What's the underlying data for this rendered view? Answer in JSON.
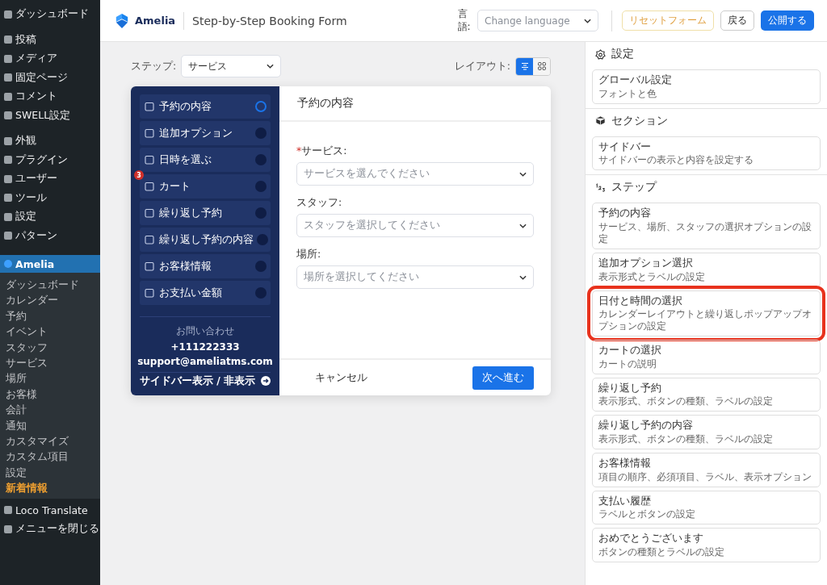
{
  "admin_menu": {
    "groups": [
      [
        {
          "label": "ダッシュボード",
          "selected": false
        }
      ],
      [
        {
          "label": "投稿",
          "selected": false
        },
        {
          "label": "メディア",
          "selected": false
        },
        {
          "label": "固定ページ",
          "selected": false
        },
        {
          "label": "コメント",
          "selected": false
        },
        {
          "label": "SWELL設定",
          "selected": false
        }
      ],
      [
        {
          "label": "外観",
          "selected": false
        },
        {
          "label": "プラグイン",
          "selected": false
        },
        {
          "label": "ユーザー",
          "selected": false
        },
        {
          "label": "ツール",
          "selected": false
        },
        {
          "label": "設定",
          "selected": false
        },
        {
          "label": "パターン",
          "selected": false
        }
      ]
    ],
    "current": {
      "label": "Amelia",
      "selected": true
    },
    "submenu": [
      {
        "label": "ダッシュボード",
        "accent": false
      },
      {
        "label": "カレンダー",
        "accent": false
      },
      {
        "label": "予約",
        "accent": false
      },
      {
        "label": "イベント",
        "accent": false
      },
      {
        "label": "スタッフ",
        "accent": false
      },
      {
        "label": "サービス",
        "accent": false
      },
      {
        "label": "場所",
        "accent": false
      },
      {
        "label": "お客様",
        "accent": false
      },
      {
        "label": "会計",
        "accent": false
      },
      {
        "label": "通知",
        "accent": false
      },
      {
        "label": "カスタマイズ",
        "accent": false
      },
      {
        "label": "カスタム項目",
        "accent": false
      },
      {
        "label": "設定",
        "accent": false
      },
      {
        "label": "新着情報",
        "accent": true
      }
    ],
    "after": [
      {
        "label": "Loco Translate",
        "selected": false
      },
      {
        "label": "メニューを閉じる",
        "selected": false
      }
    ]
  },
  "header": {
    "logo": "Amelia",
    "title": "Step-by-Step Booking Form",
    "language_label": "言語:",
    "language_placeholder": "Change language",
    "reset_button": "リセットフォーム",
    "back_button": "戻る",
    "publish_button": "公開する"
  },
  "toolbar": {
    "step_label": "ステップ:",
    "step_value": "サービス",
    "layout_label": "レイアウト:",
    "layouts": [
      {
        "kind": "list",
        "selected": true
      },
      {
        "kind": "grid",
        "selected": false
      }
    ]
  },
  "form": {
    "steps": [
      {
        "label": "予約の内容",
        "selected": true
      },
      {
        "label": "追加オプション",
        "selected": false
      },
      {
        "label": "日時を選ぶ",
        "selected": false
      },
      {
        "label": "カート",
        "selected": false,
        "badge": "3"
      },
      {
        "label": "繰り返し予約",
        "selected": false
      },
      {
        "label": "繰り返し予約の内容",
        "selected": false
      },
      {
        "label": "お客様情報",
        "selected": false
      },
      {
        "label": "お支払い金額",
        "selected": false
      }
    ],
    "contact_heading": "お問い合わせ",
    "phone": "+111222333",
    "email": "support@ameliatms.com",
    "sidebar_toggle": "サイドバー表示 / 非表示",
    "heading": "予約の内容",
    "fields": [
      {
        "marker": "*",
        "label": "サービス:",
        "placeholder": "サービスを選んでください"
      },
      {
        "label": "スタッフ:",
        "placeholder": "スタッフを選択してください"
      },
      {
        "label": "場所:",
        "placeholder": "場所を選択してください"
      }
    ],
    "cancel_button": "キャンセル",
    "next_button": "次へ進む"
  },
  "panel": {
    "sections": [
      {
        "title": "設定",
        "cards": [
          {
            "title": "グローバル設定",
            "description": "フォントと色",
            "highlighted": false
          }
        ]
      },
      {
        "title": "セクション",
        "cards": [
          {
            "title": "サイドバー",
            "description": "サイドバーの表示と内容を設定する",
            "highlighted": false
          }
        ]
      },
      {
        "title": "ステップ",
        "cards": [
          {
            "title": "予約の内容",
            "description": "サービス、場所、スタッフの選択オプションの設定",
            "highlighted": false
          },
          {
            "title": "追加オプション選択",
            "description": "表示形式とラベルの設定",
            "highlighted": false
          },
          {
            "title": "日付と時間の選択",
            "description": "カレンダーレイアウトと繰り返しポップアップオプションの設定",
            "highlighted": true
          },
          {
            "title": "カートの選択",
            "description": "カートの説明",
            "highlighted": false
          },
          {
            "title": "繰り返し予約",
            "description": "表示形式、ボタンの種類、ラベルの設定",
            "highlighted": false
          },
          {
            "title": "繰り返し予約の内容",
            "description": "表示形式、ボタンの種類、ラベルの設定",
            "highlighted": false
          },
          {
            "title": "お客様情報",
            "description": "項目の順序、必須項目、ラベル、表示オプション",
            "highlighted": false
          },
          {
            "title": "支払い履歴",
            "description": "ラベルとボタンの設定",
            "highlighted": false
          },
          {
            "title": "おめでとうございます",
            "description": "ボタンの種類とラベルの設定",
            "highlighted": false
          }
        ]
      }
    ]
  }
}
